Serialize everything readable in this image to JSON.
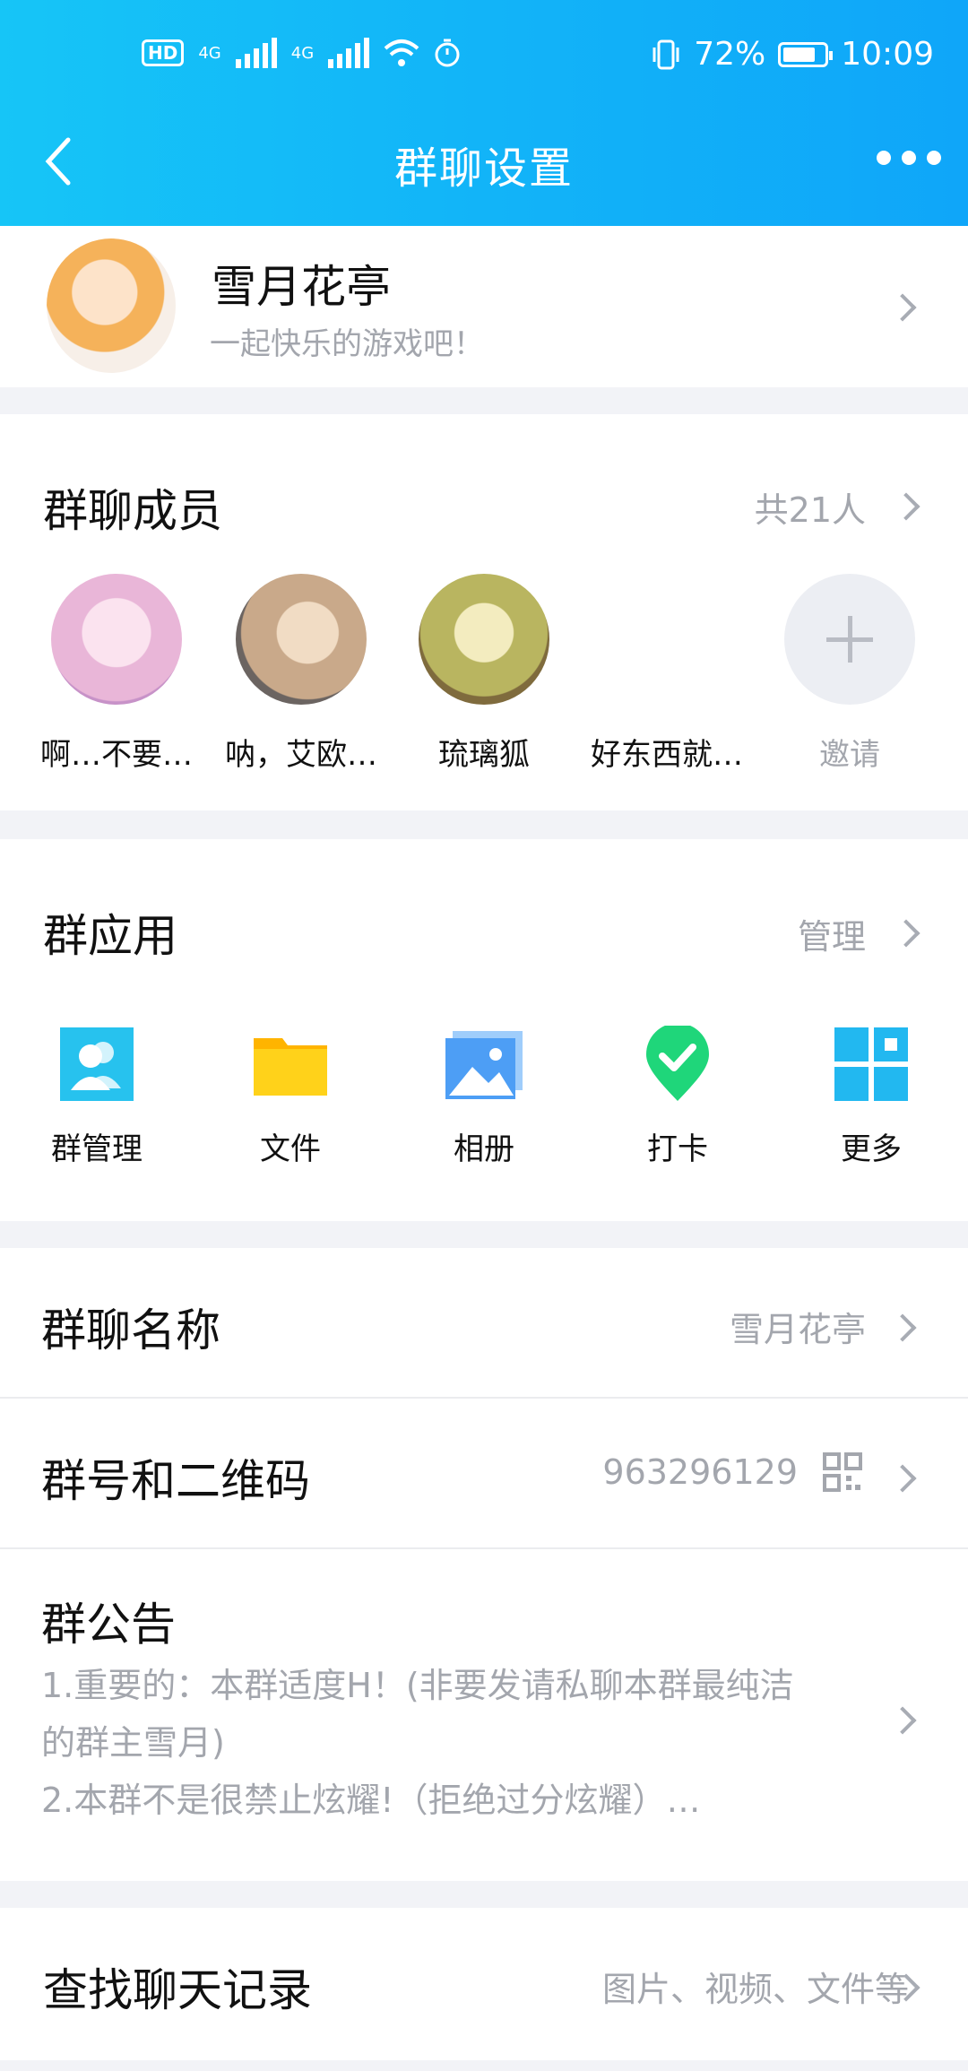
{
  "status_bar": {
    "battery": "72%",
    "time": "10:09",
    "hd": "HD",
    "net": "4G"
  },
  "nav": {
    "title": "群聊设置"
  },
  "group": {
    "name": "雪月花亭",
    "motto": "一起快乐的游戏吧！"
  },
  "members": {
    "title": "群聊成员",
    "count": "共21人",
    "list": [
      {
        "name": "啊…不要…",
        "color": "#e9b6d8"
      },
      {
        "name": "呐，艾欧…",
        "color": "#c9a98a"
      },
      {
        "name": "琉璃狐",
        "color": "#b9b560"
      },
      {
        "name": "好东西就…",
        "color": ""
      }
    ],
    "invite": "邀请"
  },
  "apps": {
    "title": "群应用",
    "manage": "管理",
    "items": [
      {
        "label": "群管理",
        "icon": "group-manage-icon",
        "color": "#27c2ee"
      },
      {
        "label": "文件",
        "icon": "folder-icon",
        "color": "#ffc21a"
      },
      {
        "label": "相册",
        "icon": "album-icon",
        "color": "#4d9ef5"
      },
      {
        "label": "打卡",
        "icon": "checkin-icon",
        "color": "#1fd67a"
      },
      {
        "label": "更多",
        "icon": "more-grid-icon",
        "color": "#22b8f0"
      }
    ]
  },
  "settings": {
    "group_name_label": "群聊名称",
    "group_name_value": "雪月花亭",
    "group_id_label": "群号和二维码",
    "group_id_value": "963296129",
    "notice_label": "群公告",
    "notice_line1": "1.重要的：本群适度H！(非要发请私聊本群最纯洁",
    "notice_line2": "的群主雪月)",
    "notice_line3": "2.本群不是很禁止炫耀!（拒绝过分炫耀）…",
    "search_label": "查找聊天记录",
    "search_hint": "图片、视频、文件等"
  }
}
